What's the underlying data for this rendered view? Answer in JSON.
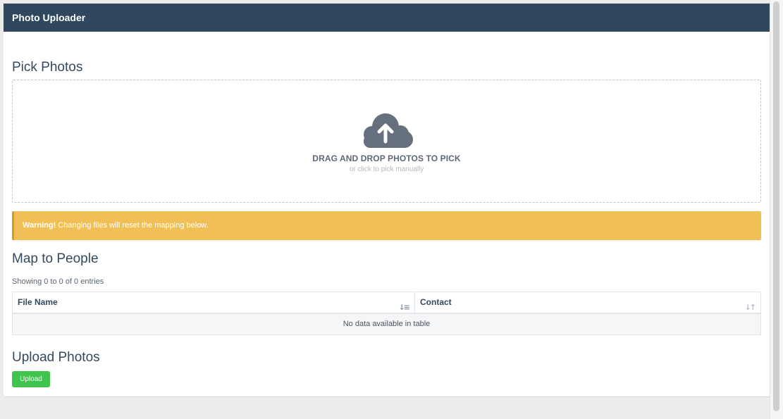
{
  "header": {
    "title": "Photo Uploader"
  },
  "pick_section": {
    "title": "Pick Photos",
    "dropzone": {
      "icon": "cloud-upload-icon",
      "title": "DRAG AND DROP PHOTOS TO PICK",
      "subtitle": "or click to pick manually"
    }
  },
  "alert": {
    "strong": "Warning!",
    "message": " Changing files will reset the mapping below.",
    "color": "#f0bf55"
  },
  "map_section": {
    "title": "Map to People",
    "info": "Showing 0 to 0 of 0 entries",
    "columns": [
      {
        "label": "File Name",
        "sort": "ascending"
      },
      {
        "label": "Contact",
        "sort": "none"
      }
    ],
    "empty_text": "No data available in table"
  },
  "upload_section": {
    "title": "Upload Photos",
    "button_label": "Upload",
    "button_color": "#3fc54d"
  }
}
